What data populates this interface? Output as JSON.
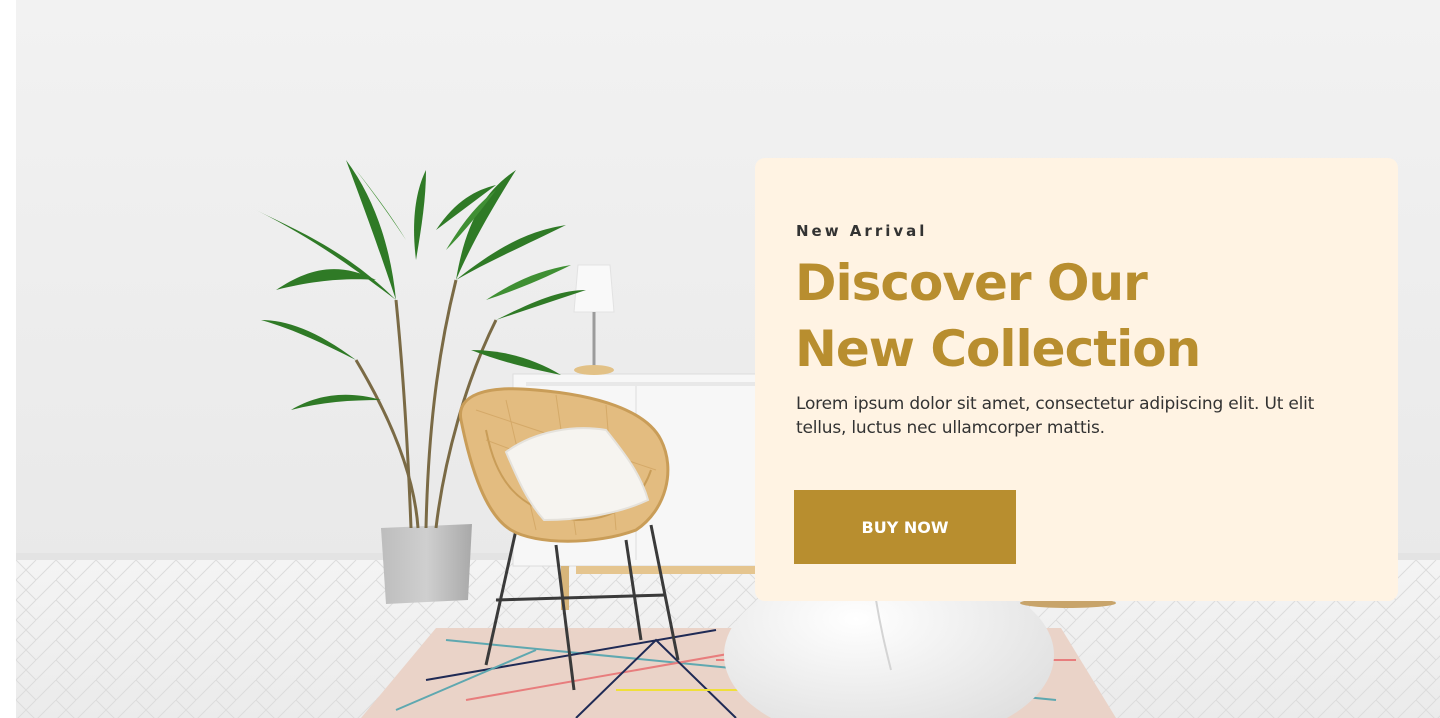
{
  "hero": {
    "eyebrow": "New Arrival",
    "headline_line1": "Discover Our",
    "headline_line2": "New Collection",
    "description": "Lorem ipsum dolor sit amet, consectetur adipiscing elit. Ut elit tellus, luctus nec ullamcorper mattis.",
    "cta_label": "BUY NOW"
  },
  "colors": {
    "accent": "#b88e2f",
    "card_background": "#fff3e3",
    "text_dark": "#333333",
    "button_text": "#ffffff"
  },
  "background_image": {
    "scene": "living-room-with-plant-chair-cabinet-lamp-rug-pouf"
  }
}
